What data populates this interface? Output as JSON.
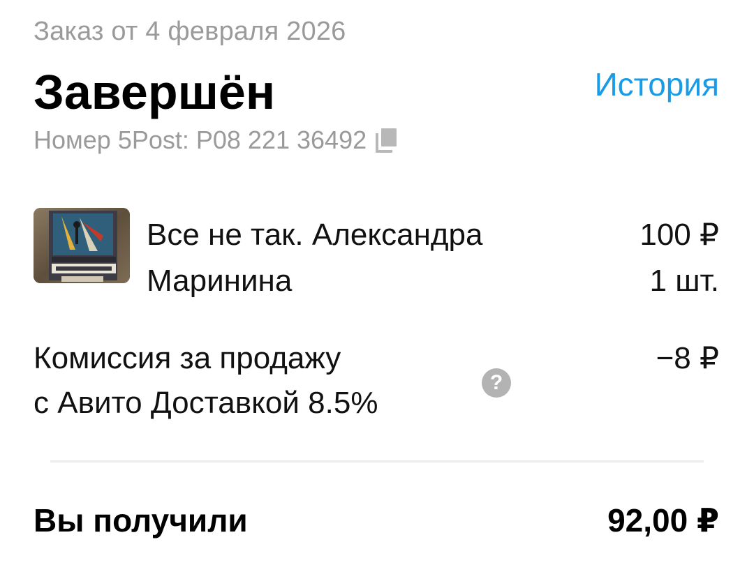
{
  "order": {
    "date_line": "Заказ от 4 февраля 2026",
    "status": "Завершён",
    "history_link": "История",
    "tracking_label": "Номер 5Post:",
    "tracking_number": "Р08 221 36492"
  },
  "item": {
    "title": "Все не так. Александра Маринина",
    "price": "100 ₽",
    "quantity": "1 шт.",
    "thumbnail_icon": "book-cover-image"
  },
  "commission": {
    "text_line1": "Комиссия за продажу",
    "text_line2": "с Авито Доставкой 8.5%",
    "amount": "−8 ₽",
    "help_icon": "question-mark-icon",
    "help_symbol": "?"
  },
  "total": {
    "label": "Вы получили",
    "value": "92,00 ₽"
  },
  "colors": {
    "accent": "#1a9be6",
    "muted_text": "#9a9a9a",
    "help_bg": "#b3b3b3",
    "divider": "#ececec"
  }
}
